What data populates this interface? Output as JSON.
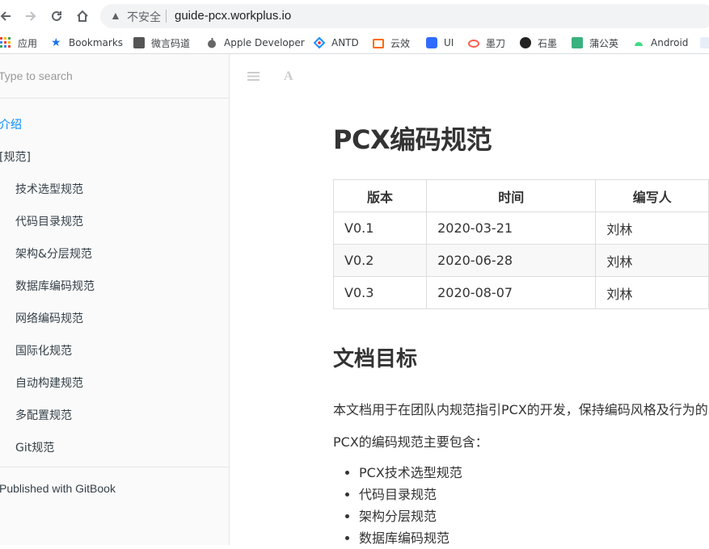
{
  "browser": {
    "insecure_label": "不安全",
    "url": "guide-pcx.workplus.io",
    "bookmarks": [
      {
        "label": "应用",
        "icon": "apps-grid-icon"
      },
      {
        "label": "Bookmarks",
        "icon": "star-icon"
      },
      {
        "label": "微言码道",
        "icon": "site-icon"
      },
      {
        "label": "Apple Developer",
        "icon": "apple-icon"
      },
      {
        "label": "ANTD",
        "icon": "antd-icon"
      },
      {
        "label": "云效",
        "icon": "yunxiao-icon"
      },
      {
        "label": "UI",
        "icon": "ui-icon"
      },
      {
        "label": "墨刀",
        "icon": "modao-icon"
      },
      {
        "label": "石墨",
        "icon": "shimo-icon"
      },
      {
        "label": "蒲公英",
        "icon": "pgyer-icon"
      },
      {
        "label": "Android",
        "icon": "android-icon"
      }
    ]
  },
  "sidebar": {
    "search_placeholder": "Type to search",
    "items": [
      {
        "label": "介绍"
      },
      {
        "label": "[规范]"
      },
      {
        "label": "技术选型规范"
      },
      {
        "label": "代码目录规范"
      },
      {
        "label": "架构&分层规范"
      },
      {
        "label": "数据库编码规范"
      },
      {
        "label": "网络编码规范"
      },
      {
        "label": "国际化规范"
      },
      {
        "label": "自动构建规范"
      },
      {
        "label": "多配置规范"
      },
      {
        "label": "Git规范"
      }
    ],
    "footer": "Published with GitBook"
  },
  "content": {
    "title": "PCX编码规范",
    "table": {
      "headers": [
        "版本",
        "时间",
        "编写人"
      ],
      "rows": [
        [
          "V0.1",
          "2020-03-21",
          "刘林"
        ],
        [
          "V0.2",
          "2020-06-28",
          "刘林"
        ],
        [
          "V0.3",
          "2020-08-07",
          "刘林"
        ]
      ]
    },
    "section_title": "文档目标",
    "para1": "本文档用于在团队内规范指引PCX的开发，保持编码风格及行为的",
    "para2": "PCX的编码规范主要包含：",
    "bullets": [
      "PCX技术选型规范",
      "代码目录规范",
      "架构分层规范",
      "数据库编码规范"
    ]
  }
}
